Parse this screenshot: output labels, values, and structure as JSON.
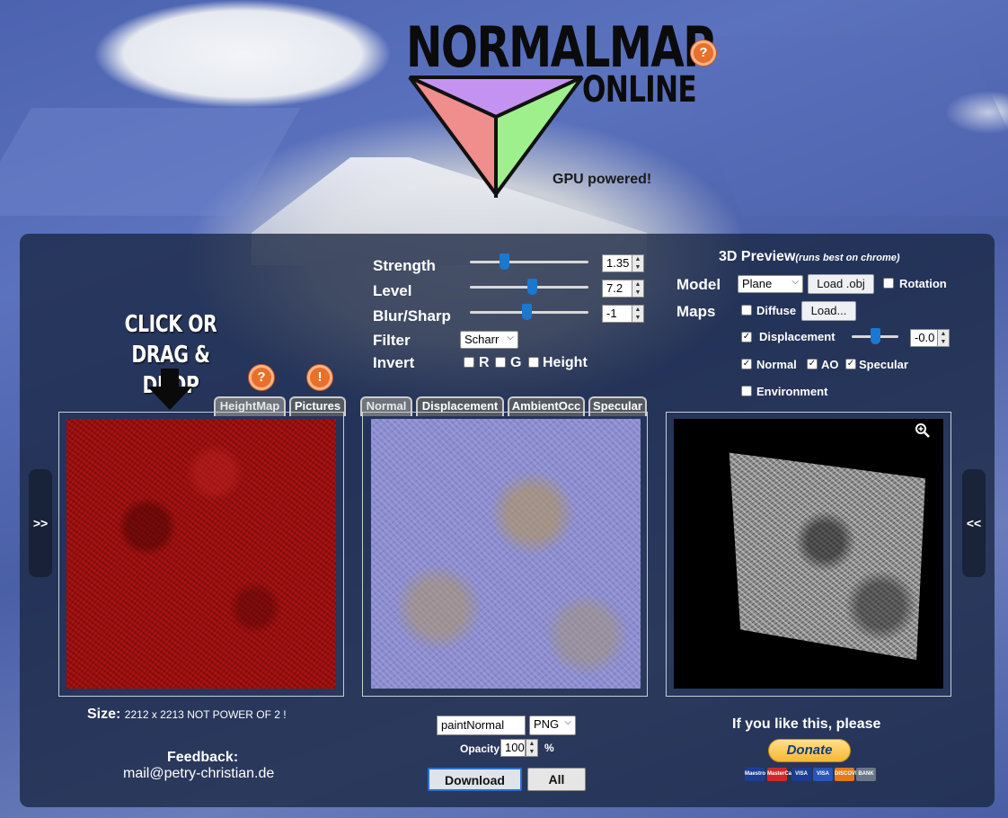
{
  "header": {
    "logo_title": "NORMALMAP",
    "logo_sub": "ONLINE",
    "tagline": "GPU powered!",
    "help_glyph": "?"
  },
  "drop_zone": {
    "line1": "CLICK OR",
    "line2": "DRAG & DROP",
    "help_glyph": "?",
    "warn_glyph": "!"
  },
  "input_tabs": [
    "HeightMap",
    "Pictures"
  ],
  "output_tabs": [
    "Normal",
    "Displacement",
    "AmbientOcc",
    "Specular"
  ],
  "controls": {
    "strength": {
      "label": "Strength",
      "value": "1.35",
      "position": 0.29
    },
    "level": {
      "label": "Level",
      "value": "7.2",
      "position": 0.52
    },
    "blur_sharp": {
      "label": "Blur/Sharp",
      "value": "-1",
      "position": 0.48
    },
    "filter": {
      "label": "Filter",
      "selected": "Scharr"
    },
    "invert": {
      "label": "Invert",
      "r": "R",
      "g": "G",
      "height": "Height"
    }
  },
  "preview_3d": {
    "title": "3D Preview",
    "subtitle": "(runs best on chrome)",
    "model_label": "Model",
    "model_selected": "Plane",
    "load_obj": "Load .obj",
    "rotation": "Rotation",
    "maps_label": "Maps",
    "diffuse": "Diffuse",
    "load_diffuse": "Load...",
    "displacement": "Displacement",
    "displacement_value": "-0.0",
    "displacement_position": 0.5,
    "normal": "Normal",
    "ao": "AO",
    "specular": "Specular",
    "environment": "Environment",
    "check": "✓"
  },
  "nav": {
    "left": ">>",
    "right": "<<"
  },
  "size": {
    "label": "Size:",
    "value": "2212 x 2213 NOT POWER OF 2 !"
  },
  "feedback": {
    "label": "Feedback:",
    "email": "mail@petry-christian.de"
  },
  "export": {
    "filename": "paintNormal",
    "format": "PNG",
    "opacity_label": "Opacity",
    "opacity_value": "100",
    "percent": "%",
    "download": "Download",
    "all": "All"
  },
  "donate": {
    "text": "If you like this, please",
    "button": "Donate",
    "cards": [
      "Maestro",
      "MasterCard",
      "VISA",
      "VISA",
      "DISCOVER",
      "BANK"
    ]
  },
  "colors": {
    "panel": "#1a2642",
    "accent": "#1b78d0",
    "help": "#e8702a",
    "heightmap": "#9e0f0f",
    "normalmap": "#8a8ccc"
  },
  "icons": {
    "zoom": "zoom-in-icon",
    "spin_up": "▲",
    "spin_down": "▼",
    "caret": "⌵"
  }
}
